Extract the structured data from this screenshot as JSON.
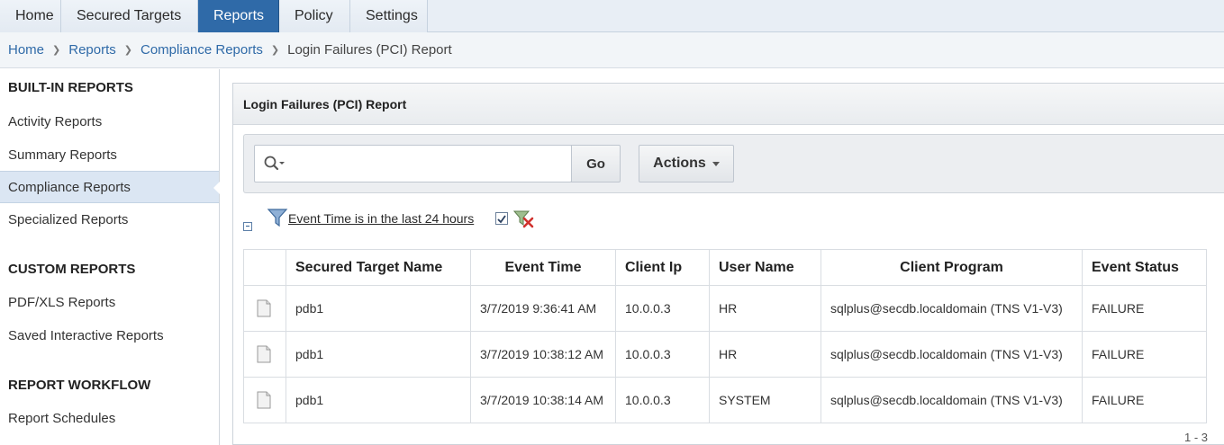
{
  "nav": {
    "tabs": [
      {
        "label": "Home"
      },
      {
        "label": "Secured Targets"
      },
      {
        "label": "Reports"
      },
      {
        "label": "Policy"
      },
      {
        "label": "Settings"
      }
    ],
    "active_tab": "Reports"
  },
  "breadcrumb": [
    "Home",
    "Reports",
    "Compliance Reports",
    "Login Failures (PCI) Report"
  ],
  "sidebar": {
    "sections": [
      {
        "heading": "BUILT-IN REPORTS",
        "items": [
          "Activity Reports",
          "Summary Reports",
          "Compliance Reports",
          "Specialized Reports"
        ]
      },
      {
        "heading": "CUSTOM REPORTS",
        "items": [
          "PDF/XLS Reports",
          "Saved Interactive Reports"
        ]
      },
      {
        "heading": "REPORT WORKFLOW",
        "items": [
          "Report Schedules"
        ]
      }
    ],
    "active_item": "Compliance Reports"
  },
  "report": {
    "title": "Login Failures (PCI) Report",
    "search": {
      "value": "",
      "placeholder": ""
    },
    "go_label": "Go",
    "actions_label": "Actions",
    "filter": {
      "label": "Event Time is in the last 24 hours",
      "enabled": true
    },
    "columns": [
      "Secured Target Name",
      "Event Time",
      "Client Ip",
      "User Name",
      "Client Program",
      "Event Status"
    ],
    "rows": [
      [
        "pdb1",
        "3/7/2019 9:36:41 AM",
        "10.0.0.3",
        "HR",
        "sqlplus@secdb.localdomain (TNS V1-V3)",
        "FAILURE"
      ],
      [
        "pdb1",
        "3/7/2019 10:38:12 AM",
        "10.0.0.3",
        "HR",
        "sqlplus@secdb.localdomain (TNS V1-V3)",
        "FAILURE"
      ],
      [
        "pdb1",
        "3/7/2019 10:38:14 AM",
        "10.0.0.3",
        "SYSTEM",
        "sqlplus@secdb.localdomain (TNS V1-V3)",
        "FAILURE"
      ]
    ],
    "pagination": "1 - 3"
  },
  "colors": {
    "accent": "#2f6aa8",
    "link": "#2f6aa8",
    "selected_bg": "#dbe6f3"
  }
}
